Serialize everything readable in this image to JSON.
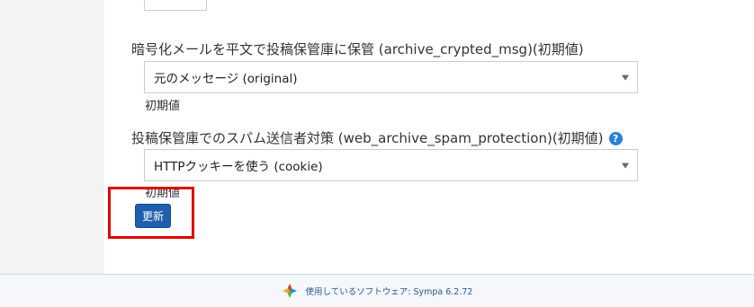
{
  "settings": {
    "archive_crypted": {
      "label": "暗号化メールを平文で投稿保管庫に保管 (archive_crypted_msg)(初期値)",
      "value": "元のメッセージ (original)",
      "hint": "初期値"
    },
    "spam_protection": {
      "label": "投稿保管庫でのスパム送信者対策 (web_archive_spam_protection)(初期値)",
      "help": "?",
      "value": "HTTPクッキーを使う (cookie)",
      "hint": "初期値"
    }
  },
  "actions": {
    "update_label": "更新"
  },
  "footer": {
    "text": "使用しているソフトウェア: Sympa 6.2.72"
  },
  "colors": {
    "accent": "#1f5fae",
    "highlight": "#e00000",
    "help": "#2a7fd6"
  }
}
